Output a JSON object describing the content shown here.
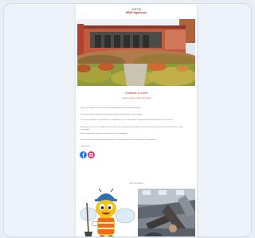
{
  "header": {
    "brand_name": "JUSTIN",
    "brand_tag": "BRAY Ingenieure"
  },
  "hero": {
    "alt": "modern building with landscaped garden"
  },
  "content": {
    "title": "Chantier à votre",
    "subtitle": "Lorem ipsum dolor sit amet",
    "paragraphs": [
      "Lorem ipsum dolor sit amet consectetur adipiscing elit sed do eiusmod tempor.",
      "Ut enim ad minim veniam quis nostrud exercitation ullamco laboris nisi ut aliquip.",
      "Duis aute irure dolor in reprehenderit in voluptate velit esse cillum dolore eu fugiat nulla pariatur excepteur sint occaecat.",
      "Excepteur sint occaecat cupidatat non proident sunt in culpa qui officia deserunt mollit anim id est laborum lorem ipsum dolor sit amet consectetur.",
      "Sed ut perspiciatis unde omnis iste natus error sit voluptatem.",
      "Nemo enim ipsam voluptatem quia voluptas sit aspernatur aut odit aut fugit sed quia consequuntur.",
      "Suivez-nous"
    ]
  },
  "social": {
    "icons": [
      "facebook-icon",
      "instagram-icon"
    ],
    "colors": {
      "facebook": "#1877f2",
      "instagram": "#d62976"
    }
  },
  "gallery": {
    "label": "Nos chantiers"
  },
  "colors": {
    "accent": "#c62828",
    "background": "#eef2f9"
  }
}
